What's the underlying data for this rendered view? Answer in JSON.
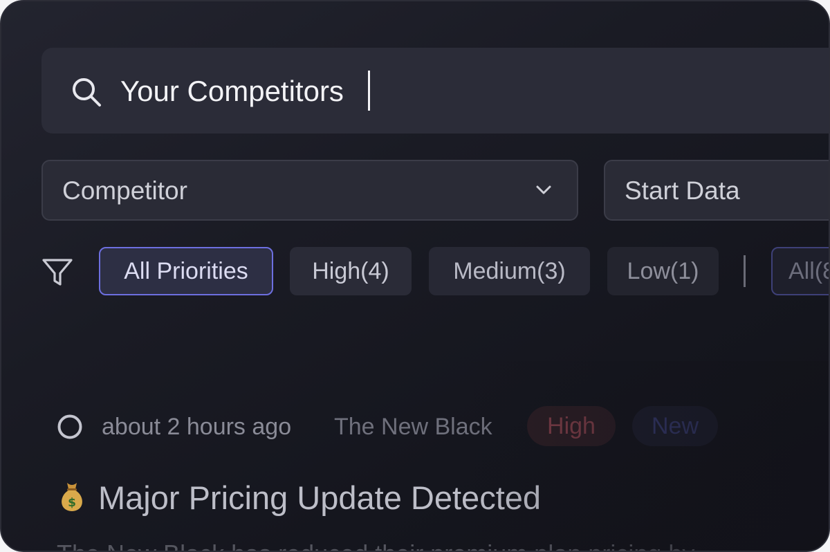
{
  "search": {
    "value": "Your Competitors",
    "icon": "search-icon"
  },
  "filters": {
    "competitor_label": "Competitor",
    "start_date_label": "Start Data"
  },
  "priorities": {
    "icon": "filter-icon",
    "items": [
      {
        "label": "All Priorities",
        "selected": true
      },
      {
        "label": "High(4)"
      },
      {
        "label": "Medium(3)"
      },
      {
        "label": "Low(1)"
      }
    ],
    "status_all_label": "All(8"
  },
  "alert": {
    "time": "about 2 hours ago",
    "company": "The New Black",
    "priority_badge": "High",
    "status_badge": "New",
    "emoji": "money-bag-icon",
    "title": "Major Pricing Update Detected",
    "description": "The New Black has reduced their premium plan pricing by"
  },
  "colors": {
    "accent": "#6d6fe0",
    "background": "#1a1b24",
    "high_badge_text": "#7a3c46",
    "new_badge_text": "#34386a"
  }
}
